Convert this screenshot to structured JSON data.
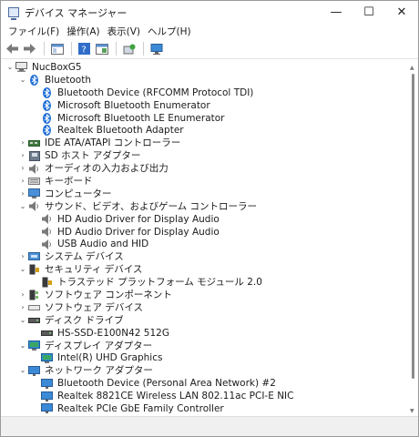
{
  "window": {
    "title": "デバイス マネージャー",
    "minimize": "—",
    "maximize": "☐",
    "close": "✕"
  },
  "menu": [
    "ファイル(F)",
    "操作(A)",
    "表示(V)",
    "ヘルプ(H)"
  ],
  "tree": {
    "root": "NucBoxG5",
    "bluetooth": {
      "label": "Bluetooth",
      "children": [
        "Bluetooth Device (RFCOMM Protocol TDI)",
        "Microsoft Bluetooth Enumerator",
        "Microsoft Bluetooth LE Enumerator",
        "Realtek Bluetooth Adapter"
      ]
    },
    "ide": "IDE ATA/ATAPI コントローラー",
    "sd": "SD ホスト アダプター",
    "audio_io": "オーディオの入力および出力",
    "keyboard": "キーボード",
    "computer": "コンピューター",
    "sound": {
      "label": "サウンド、ビデオ、およびゲーム コントローラー",
      "children": [
        "HD Audio Driver for Display Audio",
        "HD Audio Driver for Display Audio",
        "USB Audio and HID"
      ]
    },
    "system": "システム デバイス",
    "security": {
      "label": "セキュリティ デバイス",
      "children": [
        "トラステッド プラットフォーム モジュール 2.0"
      ]
    },
    "sw_component": "ソフトウェア コンポーネント",
    "sw_device": "ソフトウェア デバイス",
    "disk": {
      "label": "ディスク ドライブ",
      "children": [
        "HS-SSD-E100N42 512G"
      ]
    },
    "display": {
      "label": "ディスプレイ アダプター",
      "children": [
        "Intel(R) UHD Graphics"
      ]
    },
    "network": {
      "label": "ネットワーク アダプター",
      "children": [
        "Bluetooth Device (Personal Area Network) #2",
        "Realtek 8821CE Wireless LAN 802.11ac PCI-E NIC",
        "Realtek PCIe GbE Family Controller"
      ]
    }
  }
}
